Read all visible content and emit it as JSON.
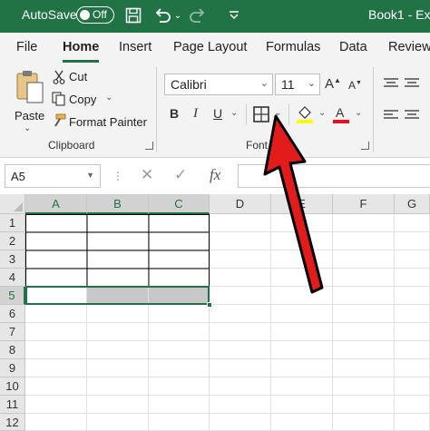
{
  "titlebar": {
    "autosave_label": "AutoSave",
    "autosave_state": "Off",
    "title": "Book1 - Ex",
    "background": "#217346",
    "icons": [
      "save-icon",
      "undo-icon",
      "redo-icon",
      "customize-toolbar-icon"
    ]
  },
  "tabs": {
    "items": [
      "File",
      "Home",
      "Insert",
      "Page Layout",
      "Formulas",
      "Data",
      "Review"
    ],
    "active": "Home",
    "accent": "#217346"
  },
  "clipboard": {
    "paste_label": "Paste",
    "cut_label": "Cut",
    "copy_label": "Copy",
    "format_painter_label": "Format Painter",
    "group_label": "Clipboard"
  },
  "font": {
    "font_name": "Calibri",
    "font_size": "11",
    "bold": "B",
    "italic": "I",
    "underline": "U",
    "group_label": "Font",
    "fill_color": "#ffff00",
    "font_color": "#e81123"
  },
  "formula_bar": {
    "name_box": "A5",
    "cancel_symbol": "✕",
    "enter_symbol": "✓",
    "function_symbol": "fx",
    "content": ""
  },
  "grid": {
    "columns": [
      "A",
      "B",
      "C",
      "D",
      "E",
      "F",
      "G"
    ],
    "rows": [
      "1",
      "2",
      "3",
      "4",
      "5",
      "6",
      "7",
      "8",
      "9",
      "10",
      "11",
      "12"
    ],
    "active_cell": "A5",
    "selected_range": "A5:C5",
    "bordered_range": "A1:C4",
    "shaded_cells": [
      "B5",
      "C5"
    ],
    "selection_color": "#217346",
    "shade_color": "#c8c8c8"
  },
  "annotation": {
    "type": "arrow",
    "points_to": "borders-dropdown",
    "color": "#e21b1b"
  }
}
